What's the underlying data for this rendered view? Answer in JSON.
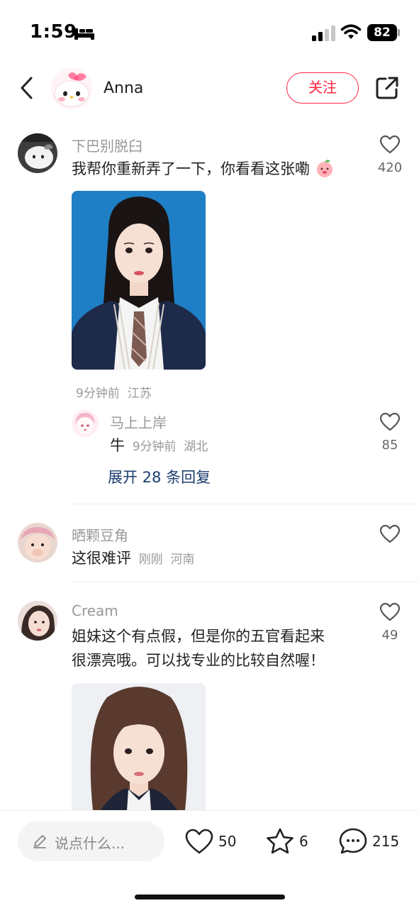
{
  "status_bar": {
    "time": "1:59",
    "battery": "82",
    "icons": [
      "bed-icon",
      "cellular-signal-icon",
      "wifi-icon",
      "battery-icon"
    ]
  },
  "header": {
    "author_name": "Anna",
    "follow_label": "关注",
    "icons": [
      "back-arrow-icon",
      "share-icon"
    ]
  },
  "comments": [
    {
      "username": "下巴别脱臼",
      "text": "我帮你重新弄了一下，你看看这张嘞",
      "emoji": "peach-emoji",
      "meta_time": "9分钟前",
      "meta_location": "江苏",
      "likes": "420",
      "has_photo": true,
      "reply": {
        "username": "马上上岸",
        "text": "牛",
        "meta_time": "9分钟前",
        "meta_location": "湖北",
        "likes": "85"
      },
      "expand_label": "展开 28 条回复"
    },
    {
      "username": "晒颗豆角",
      "text": "这很难评",
      "meta_time": "刚刚",
      "meta_location": "河南",
      "likes": ""
    },
    {
      "username": "Cream",
      "text_line1": "姐妹这个有点假，但是你的五官看起来",
      "text_line2": "很漂亮哦。可以找专业的比较自然喔！",
      "likes": "49",
      "has_photo": true
    }
  ],
  "bottom_bar": {
    "input_placeholder": "说点什么...",
    "like_count": "50",
    "star_count": "6",
    "comment_count": "215",
    "icons": [
      "pencil-icon",
      "heart-icon",
      "star-icon",
      "comment-bubble-icon"
    ]
  },
  "colors": {
    "accent_red": "#ff2442",
    "link_blue": "#1b3d6d",
    "secondary_text": "#999999"
  }
}
